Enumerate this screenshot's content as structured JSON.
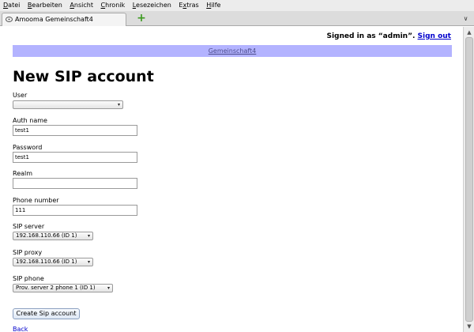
{
  "menubar": {
    "items": [
      {
        "key": "D",
        "rest": "atei"
      },
      {
        "key": "B",
        "rest": "earbeiten"
      },
      {
        "key": "A",
        "rest": "nsicht"
      },
      {
        "key": "C",
        "rest": "hronik"
      },
      {
        "key": "L",
        "rest": "esezeichen"
      },
      {
        "pre": "E",
        "key": "x",
        "rest": "tras"
      },
      {
        "key": "H",
        "rest": "ilfe"
      }
    ]
  },
  "tabbar": {
    "tab_title": "Amooma Gemeinschaft4",
    "new_tab_glyph": "+",
    "tab_list_glyph": "∨"
  },
  "header": {
    "signed_in_text": "Signed in as “admin”.",
    "sign_out_label": "Sign out",
    "tenant_link": "Gemeinschaft4"
  },
  "page": {
    "title": "New SIP account"
  },
  "form": {
    "user_label": "User",
    "user_value": "",
    "auth_name_label": "Auth name",
    "auth_name_value": "test1",
    "password_label": "Password",
    "password_value": "test1",
    "realm_label": "Realm",
    "realm_value": "",
    "phone_number_label": "Phone number",
    "phone_number_value": "111",
    "sip_server_label": "SIP server",
    "sip_server_value": "192.168.110.66 (ID 1)",
    "sip_proxy_label": "SIP proxy",
    "sip_proxy_value": "192.168.110.66 (ID 1)",
    "sip_phone_label": "SIP phone",
    "sip_phone_value": "Prov. server 2 phone 1 (ID 1)",
    "submit_label": "Create Sip account"
  },
  "footer": {
    "back_label": "Back"
  },
  "scrollbar": {
    "up_glyph": "▲",
    "down_glyph": "▼"
  },
  "colors": {
    "tenant_bar": "#b3b3ff",
    "link": "#0000cc",
    "new_tab": "#3c9a1f"
  }
}
